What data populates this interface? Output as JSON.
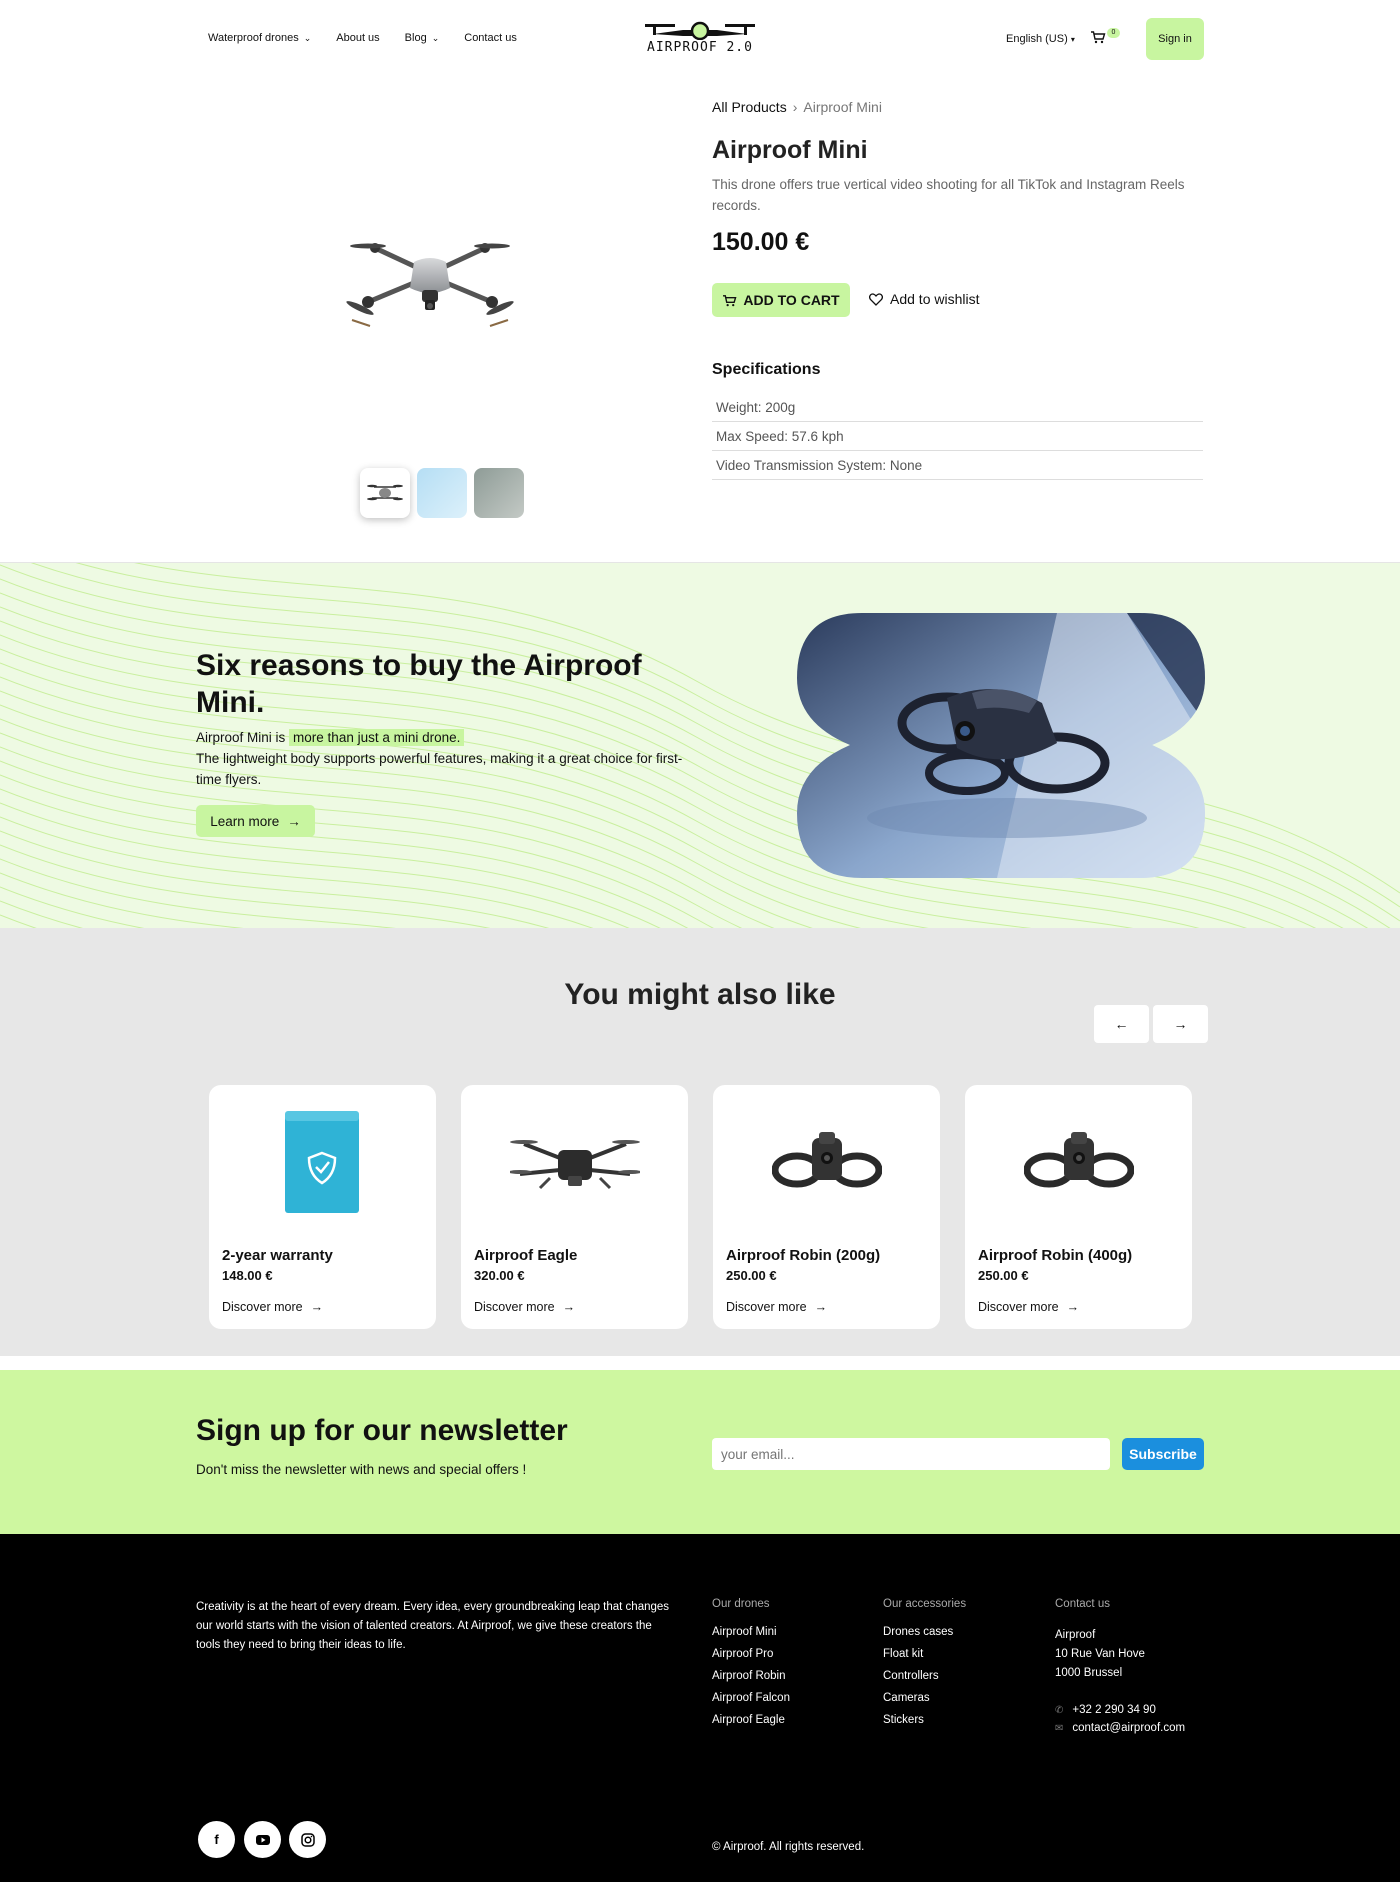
{
  "header": {
    "nav": [
      {
        "label": "Waterproof drones",
        "dropdown": true
      },
      {
        "label": "About us",
        "dropdown": false
      },
      {
        "label": "Blog",
        "dropdown": true
      },
      {
        "label": "Contact us",
        "dropdown": false
      }
    ],
    "logo_text": "AIRPROOF 2.0",
    "language": "English (US)",
    "cart_count": "0",
    "signin_label": "Sign in"
  },
  "product": {
    "breadcrumb": {
      "root": "All Products",
      "current": "Airproof Mini"
    },
    "title": "Airproof Mini",
    "description": "This drone offers true vertical video shooting for all TikTok and Instagram Reels records.",
    "price": "150.00 €",
    "add_to_cart_label": "ADD TO CART",
    "wishlist_label": "Add to wishlist",
    "specs_title": "Specifications",
    "specs": [
      "Weight: 200g",
      "Max Speed: 57.6 kph",
      "Video Transmission System: None"
    ]
  },
  "hero": {
    "title": "Six reasons to buy the Airproof Mini.",
    "text_before": "Airproof Mini is",
    "text_highlight": "more than just a mini drone.",
    "text_after": "The lightweight body supports powerful features, making it a great choice for first-time flyers.",
    "learn_more_label": "Learn more"
  },
  "related": {
    "title": "You might also like",
    "prev_label": "←",
    "next_label": "→",
    "cards": [
      {
        "name": "2-year warranty",
        "price": "148.00 €",
        "link": "Discover more",
        "icon": "warranty-box"
      },
      {
        "name": "Airproof Eagle",
        "price": "320.00 €",
        "link": "Discover more",
        "icon": "drone-eagle"
      },
      {
        "name": "Airproof Robin (200g)",
        "price": "250.00 €",
        "link": "Discover more",
        "icon": "drone-robin"
      },
      {
        "name": "Airproof Robin (400g)",
        "price": "250.00 €",
        "link": "Discover more",
        "icon": "drone-robin"
      }
    ]
  },
  "newsletter": {
    "title": "Sign up for our newsletter",
    "subtitle": "Don't miss the newsletter with news and special offers !",
    "placeholder": "your email...",
    "button_label": "Subscribe"
  },
  "footer": {
    "about": "Creativity is at the heart of every dream. Every idea, every groundbreaking leap that changes our world starts with the vision of talented creators. At Airproof, we give these creators the tools they need to bring their ideas to life.",
    "drones": {
      "title": "Our drones",
      "items": [
        "Airproof Mini",
        "Airproof Pro",
        "Airproof Robin",
        "Airproof Falcon",
        "Airproof Eagle"
      ]
    },
    "accessories": {
      "title": "Our accessories",
      "items": [
        "Drones cases",
        "Float kit",
        "Controllers",
        "Cameras",
        "Stickers"
      ]
    },
    "contact": {
      "title": "Contact us",
      "company": "Airproof",
      "street": "10 Rue Van Hove",
      "city": "1000 Brussel",
      "phone": "+32 2 290 34 90",
      "email": "contact@airproof.com"
    },
    "social": [
      "facebook-icon",
      "youtube-icon",
      "instagram-icon"
    ],
    "copyright": "© Airproof. All rights reserved."
  },
  "colors": {
    "accent": "#c8f5a0",
    "newsletter_bg": "#cef7a0",
    "subscribe": "#1b8fde",
    "footer_bg": "#000000"
  }
}
